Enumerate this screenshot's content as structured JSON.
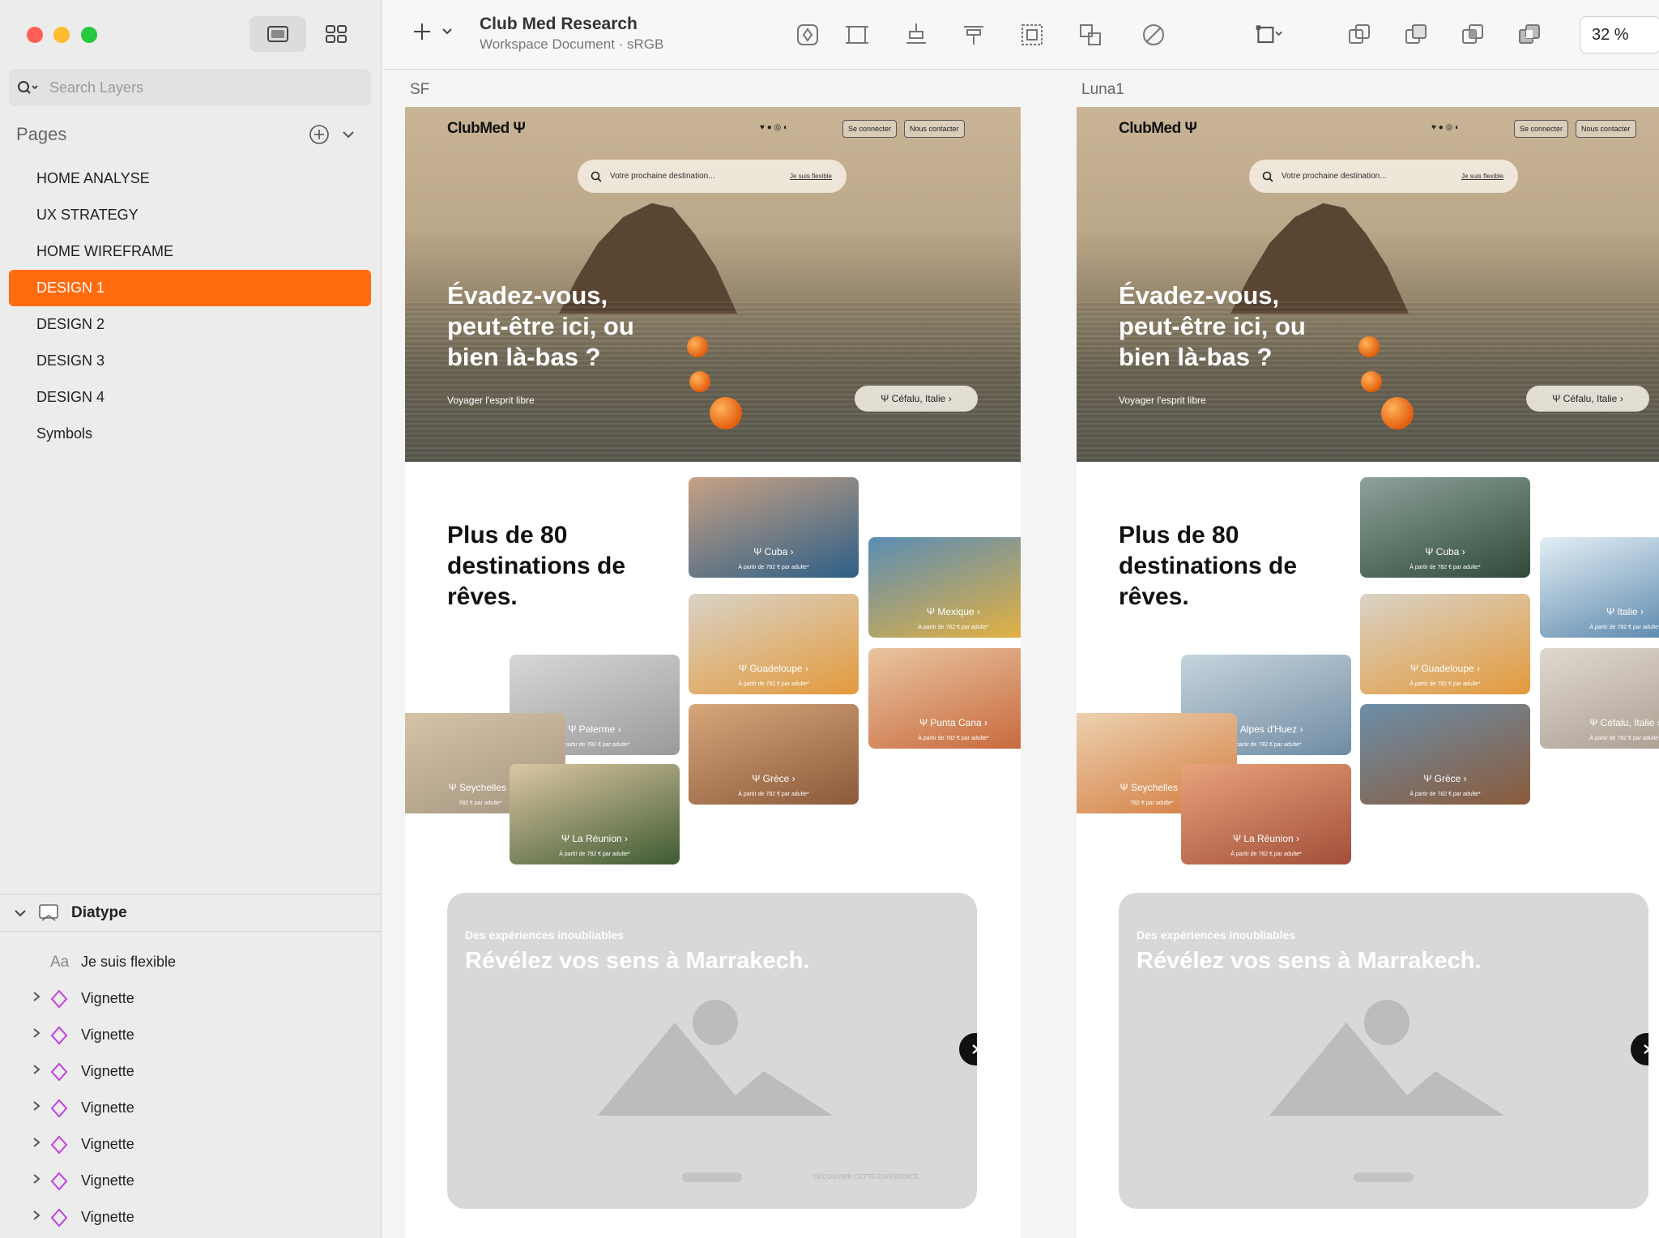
{
  "app": {
    "title": "Club Med Research",
    "subtitle": "Workspace Document · sRGB",
    "zoom": "32 %"
  },
  "sidebar": {
    "search_placeholder": "Search Layers",
    "pages_title": "Pages",
    "pages": [
      {
        "label": "HOME ANALYSE",
        "selected": false
      },
      {
        "label": "UX STRATEGY",
        "selected": false
      },
      {
        "label": "HOME WIREFRAME",
        "selected": false
      },
      {
        "label": "DESIGN 1",
        "selected": true
      },
      {
        "label": "DESIGN 2",
        "selected": false
      },
      {
        "label": "DESIGN 3",
        "selected": false
      },
      {
        "label": "DESIGN 4",
        "selected": false
      },
      {
        "label": "Symbols",
        "selected": false
      }
    ],
    "layers_group": "Diatype",
    "layers": [
      {
        "type": "text",
        "icon": "text-icon",
        "glyph": "Aa",
        "label": "Je suis flexible"
      },
      {
        "type": "symbol",
        "icon": "symbol-instance-icon",
        "label": "Vignette"
      },
      {
        "type": "symbol",
        "icon": "symbol-instance-icon",
        "label": "Vignette"
      },
      {
        "type": "symbol",
        "icon": "symbol-instance-icon",
        "label": "Vignette"
      },
      {
        "type": "symbol",
        "icon": "symbol-instance-icon",
        "label": "Vignette"
      },
      {
        "type": "symbol",
        "icon": "symbol-instance-icon",
        "label": "Vignette"
      },
      {
        "type": "symbol",
        "icon": "symbol-instance-icon",
        "label": "Vignette"
      },
      {
        "type": "symbol",
        "icon": "symbol-instance-icon",
        "label": "Vignette"
      }
    ]
  },
  "toolbar": {
    "icons": [
      "create-symbol-icon",
      "artboard-icon",
      "distribute-icon",
      "align-icon",
      "group-icon",
      "ungroup-icon",
      "edit-icon",
      "resize-icon",
      "union-icon",
      "subtract-icon",
      "intersect-icon",
      "difference-icon"
    ]
  },
  "colors": {
    "accent": "#ff6b0f",
    "canvas": "#f4f4f4",
    "sidebar": "#ececec",
    "symbol": "#c040e0"
  },
  "artboards": [
    {
      "label": "SF",
      "logo": "ClubMed Ψ",
      "connect": "Se connecter",
      "contact": "Nous contacter",
      "search_placeholder": "Votre prochaine destination...",
      "flexible": "Je suis flexible",
      "hero_title": "Évadez-vous, peut-être ici, ou bien là-bas ?",
      "hero_tagline": "Voyager l'esprit libre",
      "location": "Céfalu, Italie",
      "dest_title": "Plus de 80 destinations de rêves.",
      "cards": [
        {
          "name": "Cuba",
          "price": "À partir de 782 € par adulte*",
          "palette": [
            "#2e5f86",
            "#c7a184"
          ]
        },
        {
          "name": "Mexique",
          "price": "À partir de 782 € par adulte*",
          "palette": [
            "#e8b23e",
            "#5a8db5"
          ]
        },
        {
          "name": "Guadeloupe",
          "price": "À partir de 782 € par adulte*",
          "palette": [
            "#e39a3d",
            "#d9d3c6"
          ]
        },
        {
          "name": "Palerme",
          "price": "À partir de 782 € par adulte*",
          "palette": [
            "#9a9a9a",
            "#d7d7d7"
          ]
        },
        {
          "name": "Punta Cana",
          "price": "À partir de 782 € par adulte*",
          "palette": [
            "#c8663a",
            "#e8c5a0"
          ]
        },
        {
          "name": "Seychelles",
          "price": "782 € par adulte*",
          "palette": [
            "#a59680",
            "#d6c4a8"
          ]
        },
        {
          "name": "Grèce",
          "price": "À partir de 782 € par adulte*",
          "palette": [
            "#8b5a3a",
            "#d8a67b"
          ]
        },
        {
          "name": "La Réunion",
          "price": "À partir de 782 € par adulte*",
          "palette": [
            "#3f5b32",
            "#dcc7a3"
          ]
        }
      ],
      "promo_kicker": "Des expériences inoubliables",
      "promo_title": "Révélez vos sens à Marrakech.",
      "promo_cta": "DÉCOUVRIR CETTE EXPÉRIENCE"
    },
    {
      "label": "Luna1",
      "logo": "ClubMed Ψ",
      "connect": "Se connecter",
      "contact": "Nous contacter",
      "search_placeholder": "Votre prochaine destination...",
      "flexible": "Je suis flexible",
      "hero_title": "Évadez-vous, peut-être ici, ou bien là-bas ?",
      "hero_tagline": "Voyager l'esprit libre",
      "location": "Céfalu, Italie",
      "dest_title": "Plus de 80 destinations de rêves.",
      "cards": [
        {
          "name": "Cuba",
          "price": "À partir de 782 € par adulte*",
          "palette": [
            "#2f4a3a",
            "#8ea29a"
          ]
        },
        {
          "name": "Italie",
          "price": "À partir de 782 € par adulte*",
          "palette": [
            "#4f7fa6",
            "#e3eef5"
          ]
        },
        {
          "name": "Guadeloupe",
          "price": "À partir de 782 € par adulte*",
          "palette": [
            "#e39a3d",
            "#d9d3c6"
          ]
        },
        {
          "name": "Alpes d'Huez",
          "price": "À partir de 782 € par adulte*",
          "palette": [
            "#6f8ca3",
            "#c7d4dd"
          ]
        },
        {
          "name": "Céfalu, Italie",
          "price": "À partir de 782 € par adulte*",
          "palette": [
            "#a79a8d",
            "#e0d8cf"
          ]
        },
        {
          "name": "Seychelles",
          "price": "782 € par adulte*",
          "palette": [
            "#d47b3e",
            "#ecd3b2"
          ]
        },
        {
          "name": "Grèce",
          "price": "À partir de 782 € par adulte*",
          "palette": [
            "#8b5a3a",
            "#6b8fa9"
          ]
        },
        {
          "name": "La Réunion",
          "price": "À partir de 782 € par adulte*",
          "palette": [
            "#a24f3a",
            "#e9a27b"
          ]
        }
      ],
      "promo_kicker": "Des expériences inoubliables",
      "promo_title": "Révélez vos sens à Marrakech.",
      "promo_cta": ""
    }
  ]
}
